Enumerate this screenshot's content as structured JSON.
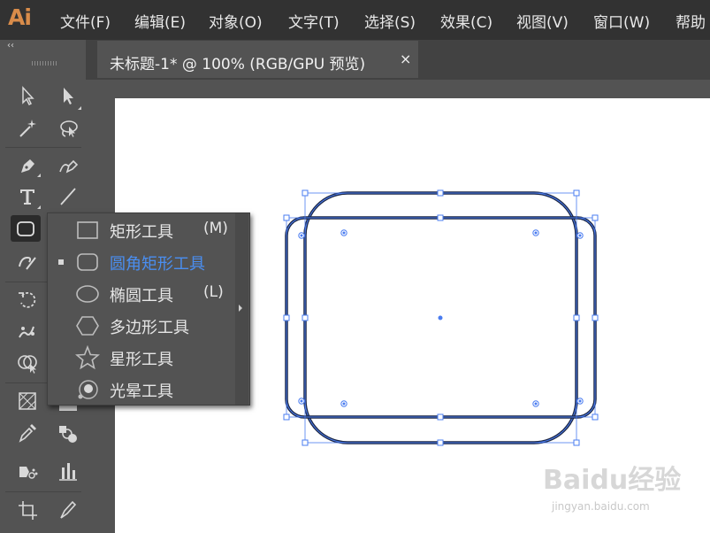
{
  "app": {
    "logo": "Ai"
  },
  "menu": [
    {
      "label": "文件(F)"
    },
    {
      "label": "编辑(E)"
    },
    {
      "label": "对象(O)"
    },
    {
      "label": "文字(T)"
    },
    {
      "label": "选择(S)"
    },
    {
      "label": "效果(C)"
    },
    {
      "label": "视图(V)"
    },
    {
      "label": "窗口(W)"
    },
    {
      "label": "帮助"
    }
  ],
  "document_tab": {
    "title": "未标题-1* @ 100% (RGB/GPU 预览)",
    "close": "×"
  },
  "toolbar": {
    "collapse": "‹‹"
  },
  "flyout": {
    "items": [
      {
        "label": "矩形工具",
        "shortcut": "(M)",
        "icon": "rectangle-icon",
        "selected": false
      },
      {
        "label": "圆角矩形工具",
        "shortcut": "",
        "icon": "rounded-rectangle-icon",
        "selected": true
      },
      {
        "label": "椭圆工具",
        "shortcut": "(L)",
        "icon": "ellipse-icon",
        "selected": false
      },
      {
        "label": "多边形工具",
        "shortcut": "",
        "icon": "polygon-icon",
        "selected": false
      },
      {
        "label": "星形工具",
        "shortcut": "",
        "icon": "star-icon",
        "selected": false
      },
      {
        "label": "光晕工具",
        "shortcut": "",
        "icon": "flare-icon",
        "selected": false
      }
    ]
  },
  "colors": {
    "selection": "#4a7cf0",
    "accent_text": "#4a8ef0",
    "logo": "#d98c4a"
  },
  "watermark": {
    "text": "Baidu经验",
    "sub": "jingyan.baidu.com"
  }
}
